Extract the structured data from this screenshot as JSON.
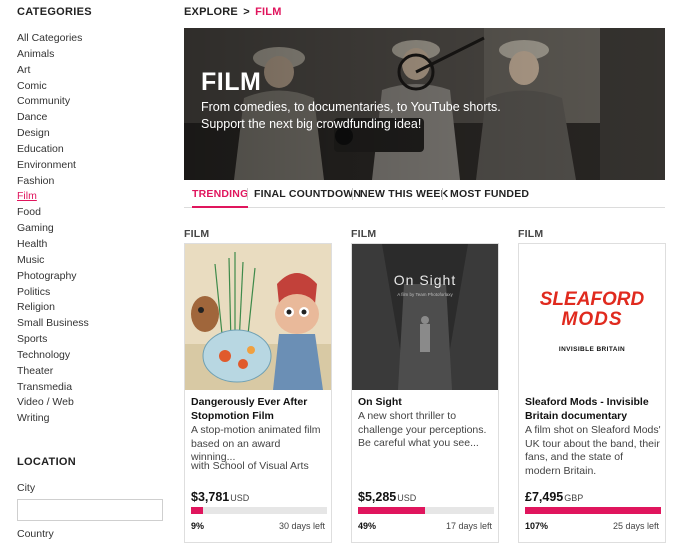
{
  "sidebar": {
    "categories_heading": "CATEGORIES",
    "categories": [
      "All Categories",
      "Animals",
      "Art",
      "Comic",
      "Community",
      "Dance",
      "Design",
      "Education",
      "Environment",
      "Fashion",
      "Film",
      "Food",
      "Gaming",
      "Health",
      "Music",
      "Photography",
      "Politics",
      "Religion",
      "Small Business",
      "Sports",
      "Technology",
      "Theater",
      "Transmedia",
      "Video / Web",
      "Writing"
    ],
    "active_category": "Film",
    "location_heading": "LOCATION",
    "city_label": "City",
    "city_value": "",
    "country_label": "Country"
  },
  "breadcrumb": {
    "explore": "EXPLORE",
    "separator": ">",
    "current": "FILM"
  },
  "hero": {
    "title": "FILM",
    "subtitle": "From comedies, to documentaries, to YouTube shorts. Support the next big crowdfunding idea!"
  },
  "tabs": [
    {
      "label": "TRENDING",
      "active": true
    },
    {
      "label": "FINAL COUNTDOWN",
      "active": false
    },
    {
      "label": "NEW THIS WEEK",
      "active": false
    },
    {
      "label": "MOST FUNDED",
      "active": false
    }
  ],
  "accent_color": "#e0155d",
  "cards": [
    {
      "category": "FILM",
      "title": "Dangerously Ever After Stopmotion Film",
      "description": "A stop-motion animated film based on an award winning...",
      "author": "with School of Visual Arts",
      "amount": "$3,781",
      "currency": "USD",
      "percent": "9%",
      "progress": 0.09,
      "days_left": "30 days left",
      "image_icon": "storybook-illustration-image"
    },
    {
      "category": "FILM",
      "title": "On Sight",
      "description": "A new short thriller to challenge your perceptions. Be careful what you see...",
      "author": "",
      "amount": "$5,285",
      "currency": "USD",
      "percent": "49%",
      "progress": 0.49,
      "days_left": "17 days left",
      "image_title": "On Sight",
      "image_subtitle": "A film by Team Photoforlaxy"
    },
    {
      "category": "FILM",
      "title": "Sleaford Mods - Invisible Britain documentary",
      "description": "A film shot on Sleaford Mods' UK tour about the band, their fans, and the state of modern Britain.",
      "author": "",
      "amount": "£7,495",
      "currency": "GBP",
      "percent": "107%",
      "progress": 1.0,
      "days_left": "25 days left",
      "logo_line1": "SLEAFORD",
      "logo_line2": "MODS",
      "logo_tagline": "INVISIBLE BRITAIN"
    }
  ]
}
